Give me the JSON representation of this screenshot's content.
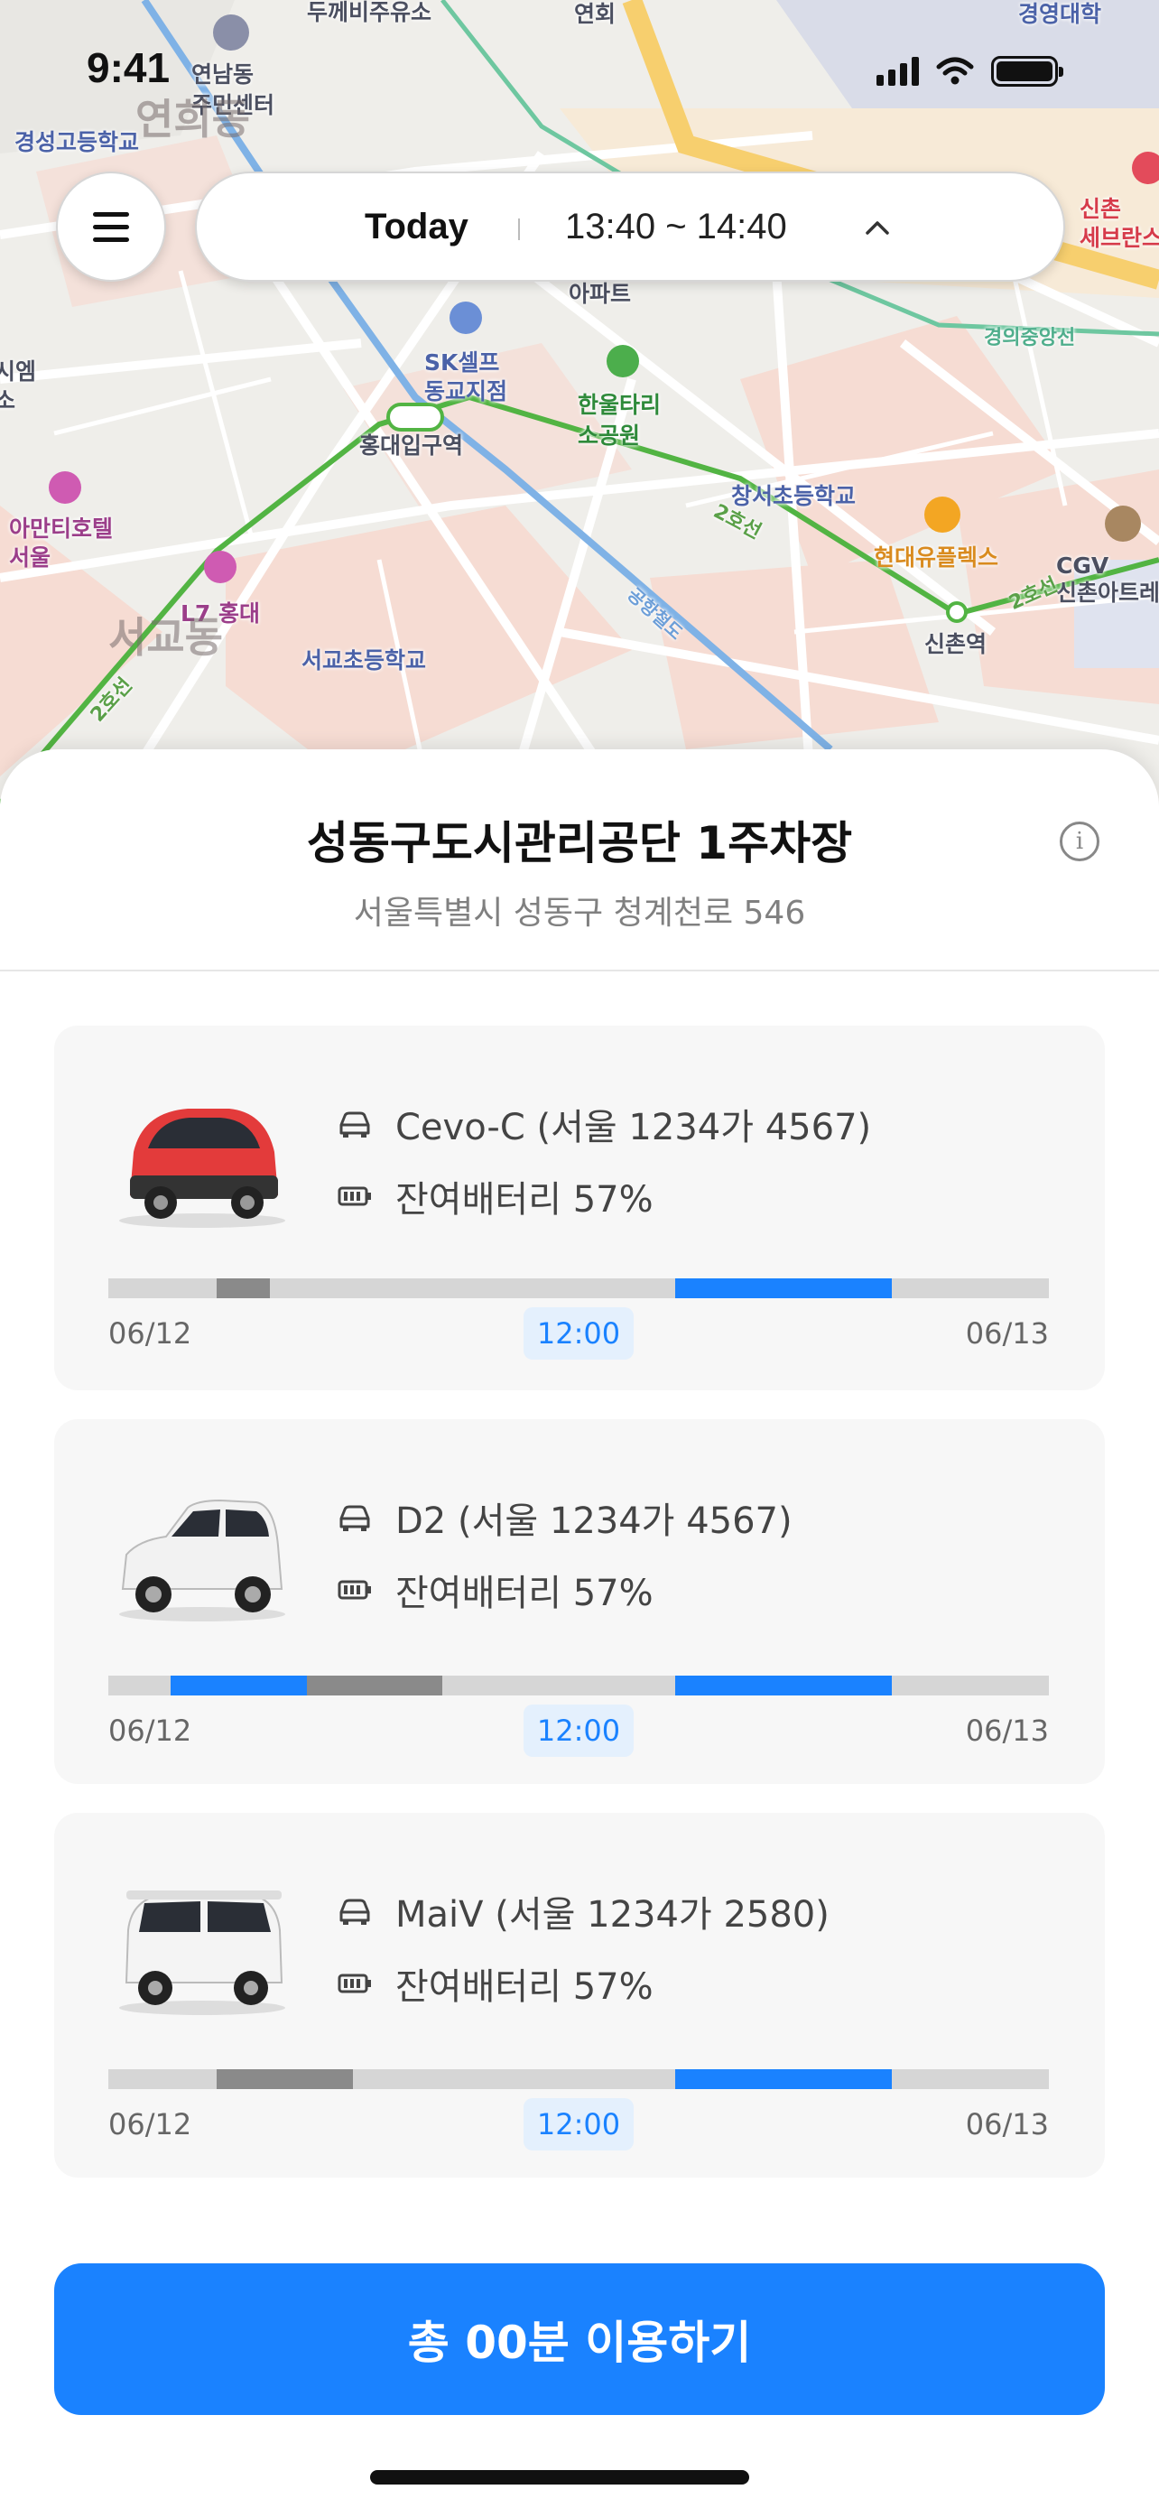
{
  "status_bar": {
    "time": "9:41"
  },
  "map": {
    "labels": {
      "l0": "두께비주유소",
      "l1": "연회",
      "l2": "경영대학",
      "l3": "연남동\n주민센터",
      "l4": "경성고등학교",
      "l5": "연희동",
      "l6": "아파트",
      "l7": "SK셀프\n동교지점",
      "l8": "홍대입구역",
      "l9": "한울타리\n소공원",
      "l10": "창서초등학교",
      "l11": "현대유플렉스",
      "l12": "CGV\n신촌아트레",
      "l13": "신촌역",
      "l14": "아만티호텔\n서울",
      "l15": "L7 홍대",
      "l16": "서교동",
      "l17": "서교초등학교",
      "l18": "신촌\n세브란스",
      "l19": "2호선",
      "l20": "경의중앙선",
      "l21": "공항철도",
      "l22": "시엠\n소"
    }
  },
  "top": {
    "day_label": "Today",
    "time_range": "13:40 ~ 14:40"
  },
  "lot": {
    "name": "성동구도시관리공단 1주차장",
    "address": "서울특별시 성동구 청계천로 546"
  },
  "cars": [
    {
      "name": "Cevo-C (서울 1234가 4567)",
      "battery": "잔여배터리 57%",
      "start": "06/12",
      "mid": "12:00",
      "end": "06/13",
      "color": "#e33b3b",
      "segments": [
        {
          "type": "gray",
          "from": 0.115,
          "to": 0.172
        },
        {
          "type": "blue",
          "from": 0.603,
          "to": 0.833
        }
      ]
    },
    {
      "name": "D2 (서울 1234가 4567)",
      "battery": "잔여배터리 57%",
      "start": "06/12",
      "mid": "12:00",
      "end": "06/13",
      "color": "#f2f2f2",
      "segments": [
        {
          "type": "blue",
          "from": 0.066,
          "to": 0.211
        },
        {
          "type": "gray",
          "from": 0.211,
          "to": 0.355
        },
        {
          "type": "blue",
          "from": 0.603,
          "to": 0.833
        }
      ]
    },
    {
      "name": "MaiV (서울 1234가 2580)",
      "battery": "잔여배터리 57%",
      "start": "06/12",
      "mid": "12:00",
      "end": "06/13",
      "color": "#f4f4f4",
      "segments": [
        {
          "type": "gray",
          "from": 0.115,
          "to": 0.26
        },
        {
          "type": "blue",
          "from": 0.603,
          "to": 0.833
        }
      ]
    }
  ],
  "cta": {
    "label": "총 00분 이용하기"
  },
  "colors": {
    "accent": "#1a82ff",
    "booked": "#8a8a8a",
    "free": "#d6d6d6"
  }
}
